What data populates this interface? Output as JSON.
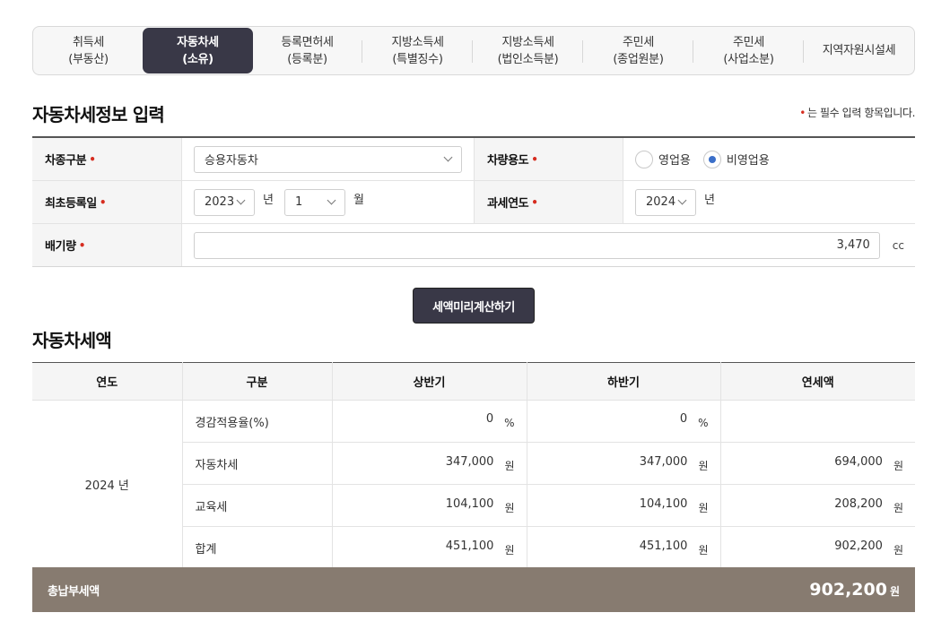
{
  "tabs": [
    {
      "line1": "취득세",
      "line2": "(부동산)"
    },
    {
      "line1": "자동차세",
      "line2": "(소유)"
    },
    {
      "line1": "등록면허세",
      "line2": "(등록분)"
    },
    {
      "line1": "지방소득세",
      "line2": "(특별징수)"
    },
    {
      "line1": "지방소득세",
      "line2": "(법인소득분)"
    },
    {
      "line1": "주민세",
      "line2": "(종업원분)"
    },
    {
      "line1": "주민세",
      "line2": "(사업소분)"
    },
    {
      "line1": "지역자원시설세",
      "line2": ""
    }
  ],
  "active_tab": "자동차세 (소유)",
  "form": {
    "title": "자동차세정보 입력",
    "required_note": "는 필수 입력 항목입니다.",
    "required_mark": "•",
    "vehicle_type_label": "차종구분",
    "vehicle_type_value": "승용자동차",
    "usage_label": "차량용도",
    "usage_options": [
      "영업용",
      "비영업용"
    ],
    "usage_selected": "비영업용",
    "first_reg_label": "최초등록일",
    "first_reg_year": "2023",
    "year_unit": "년",
    "first_reg_month": "1",
    "month_unit": "월",
    "tax_year_label": "과세연도",
    "tax_year_value": "2024",
    "displacement_label": "배기량",
    "displacement_value": "3,470",
    "displacement_unit": "cc"
  },
  "calc_button": "세액미리계산하기",
  "result": {
    "title": "자동차세액",
    "headers": [
      "연도",
      "구분",
      "상반기",
      "하반기",
      "연세액"
    ],
    "year": "2024 년",
    "rows": [
      {
        "kind": "경감적용율(%)",
        "first": "0",
        "first_unit": "%",
        "second": "0",
        "second_unit": "%",
        "annual": "",
        "annual_unit": ""
      },
      {
        "kind": "자동차세",
        "first": "347,000",
        "first_unit": "원",
        "second": "347,000",
        "second_unit": "원",
        "annual": "694,000",
        "annual_unit": "원"
      },
      {
        "kind": "교육세",
        "first": "104,100",
        "first_unit": "원",
        "second": "104,100",
        "second_unit": "원",
        "annual": "208,200",
        "annual_unit": "원"
      },
      {
        "kind": "합계",
        "first": "451,100",
        "first_unit": "원",
        "second": "451,100",
        "second_unit": "원",
        "annual": "902,200",
        "annual_unit": "원"
      }
    ],
    "total_label": "총납부세액",
    "total_value": "902,200",
    "total_unit": "원"
  },
  "colors": {
    "active_tab_bg": "#393847",
    "button_bg": "#393847",
    "total_bar_bg": "#877b70",
    "required_mark": "#d62d20",
    "radio_selected": "#3b6fc9"
  }
}
